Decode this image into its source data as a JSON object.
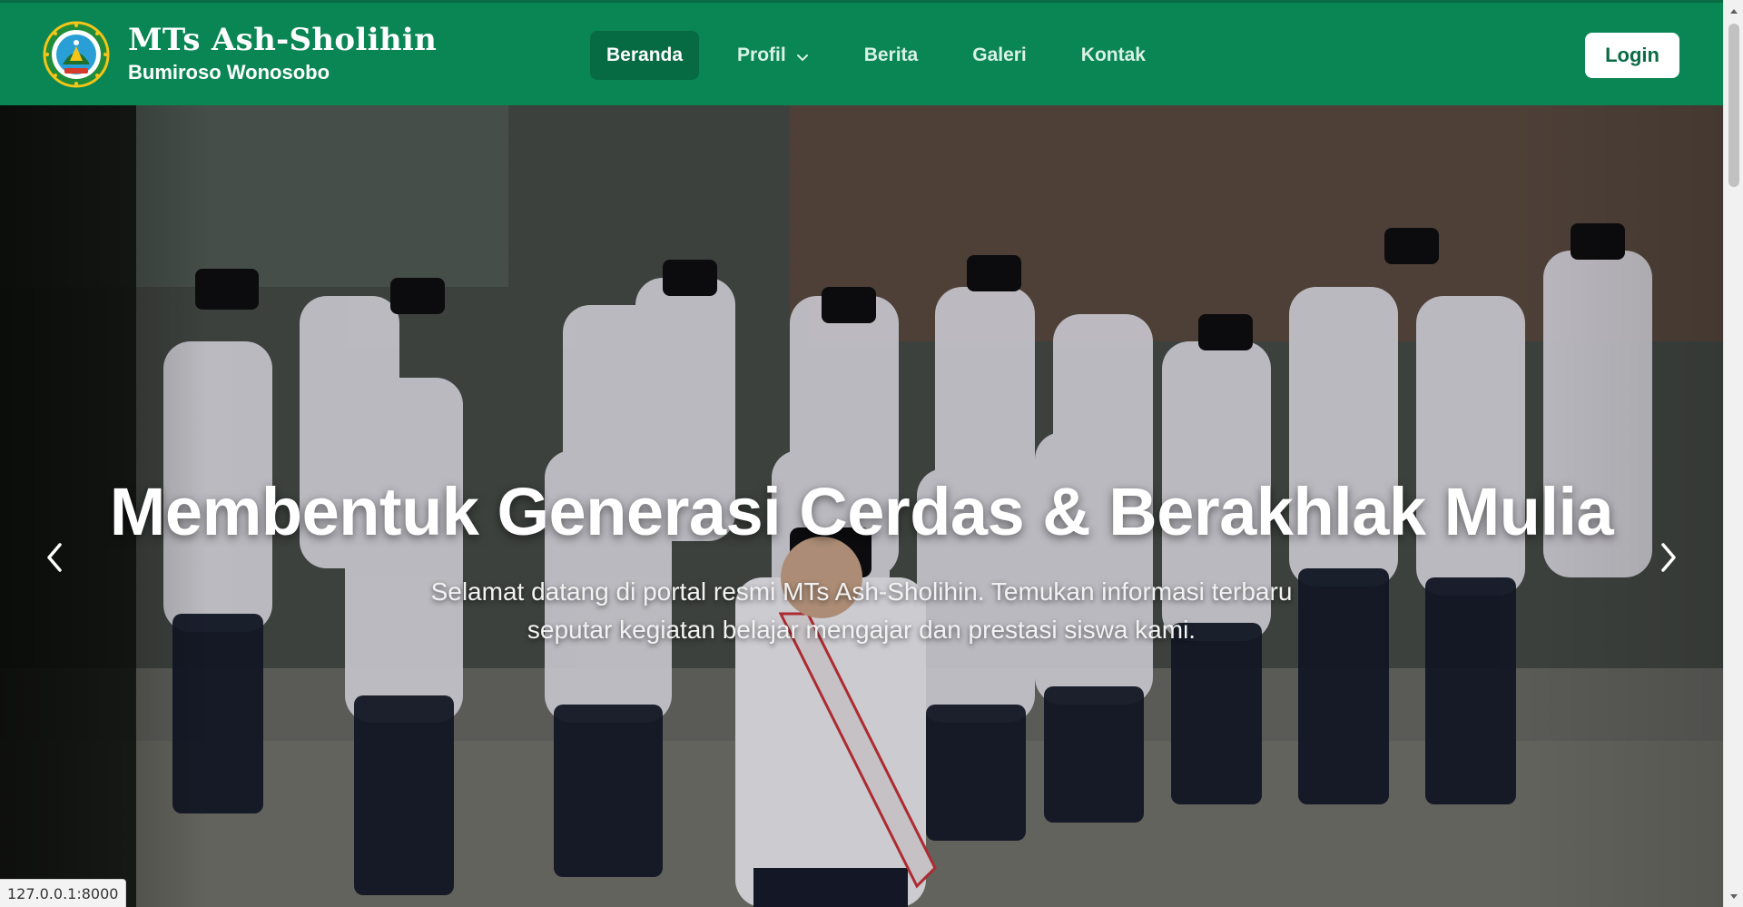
{
  "brand": {
    "title": "MTs Ash-Sholihin",
    "subtitle": "Bumiroso Wonosobo",
    "logo_icon": "school-emblem-icon"
  },
  "nav": {
    "items": [
      {
        "label": "Beranda",
        "active": true
      },
      {
        "label": "Profil",
        "has_dropdown": true
      },
      {
        "label": "Berita"
      },
      {
        "label": "Galeri"
      },
      {
        "label": "Kontak"
      }
    ],
    "login_label": "Login"
  },
  "hero": {
    "title": "Membentuk Generasi Cerdas & Berakhlak Mulia",
    "description_line1": "Selamat datang di portal resmi MTs Ash-Sholihin. Temukan informasi terbaru",
    "description_line2": "seputar kegiatan belajar mengajar dan prestasi siswa kami.",
    "prev_icon": "chevron-left-icon",
    "next_icon": "chevron-right-icon"
  },
  "status_bar": {
    "url": "127.0.0.1:8000"
  },
  "colors": {
    "primary_green": "#0a8554",
    "active_nav": "#066a43",
    "white": "#ffffff"
  }
}
